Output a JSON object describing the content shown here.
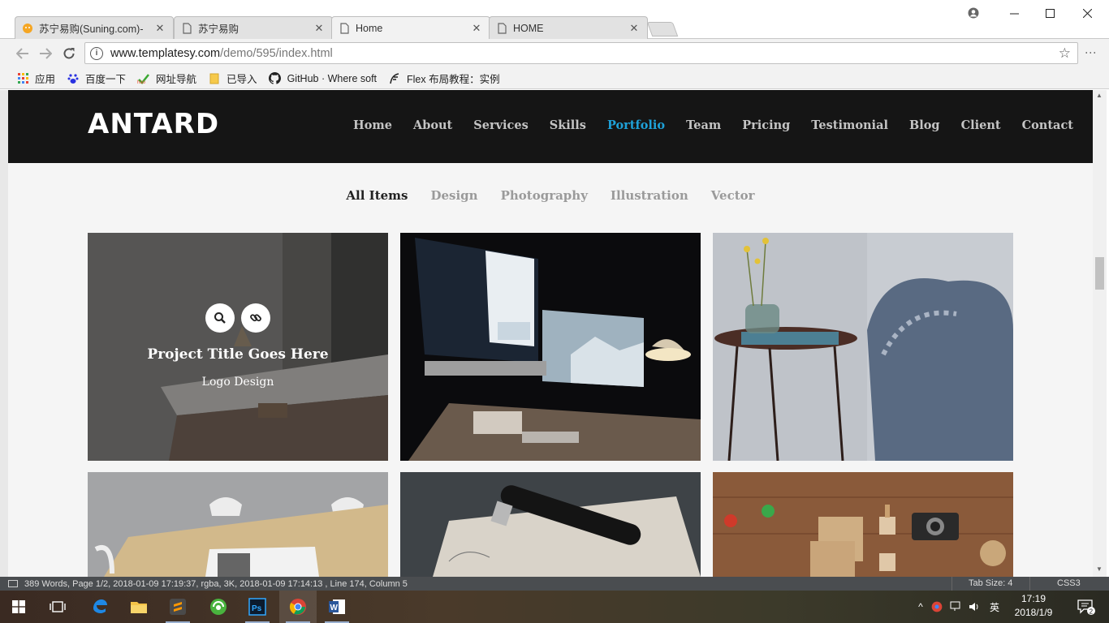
{
  "browser": {
    "tabs": [
      {
        "title": "苏宁易购(Suning.com)-",
        "icon": "suning-icon"
      },
      {
        "title": "苏宁易购",
        "icon": "page-icon"
      },
      {
        "title": "Home",
        "icon": "page-icon",
        "active": true
      },
      {
        "title": "HOME",
        "icon": "page-icon"
      }
    ],
    "url_domain": "www.templatesy.com",
    "url_path": "/demo/595/index.html",
    "bookmarks": [
      {
        "label": "应用",
        "icon": "apps-grid-icon"
      },
      {
        "label": "百度一下",
        "icon": "baidu-paw-icon"
      },
      {
        "label": "网址导航",
        "icon": "hao-icon"
      },
      {
        "label": "已导入",
        "icon": "folder-icon"
      },
      {
        "label": "GitHub · Where soft",
        "icon": "github-icon"
      },
      {
        "label": "Flex 布局教程：实例",
        "icon": "feather-icon"
      }
    ]
  },
  "site": {
    "logo": "ANTARD",
    "menu": [
      "Home",
      "About",
      "Services",
      "Skills",
      "Portfolio",
      "Team",
      "Pricing",
      "Testimonial",
      "Blog",
      "Client",
      "Contact"
    ],
    "active_menu": "Portfolio",
    "accent_color": "#1ea1d8",
    "filters": [
      "All Items",
      "Design",
      "Photography",
      "Illustration",
      "Vector"
    ],
    "active_filter": "All Items",
    "overlay": {
      "title": "Project Title Goes Here",
      "subtitle": "Logo Design"
    }
  },
  "statusbar": {
    "text": "389 Words, Page 1/2, 2018-01-09 17:19:37, rgba, 3K, 2018-01-09 17:14:13 , Line 174, Column 5",
    "tab_size": "Tab Size: 4",
    "syntax": "CSS3"
  },
  "taskbar": {
    "ime": "英",
    "time": "17:19",
    "date": "2018/1/9",
    "notifications": "2"
  }
}
